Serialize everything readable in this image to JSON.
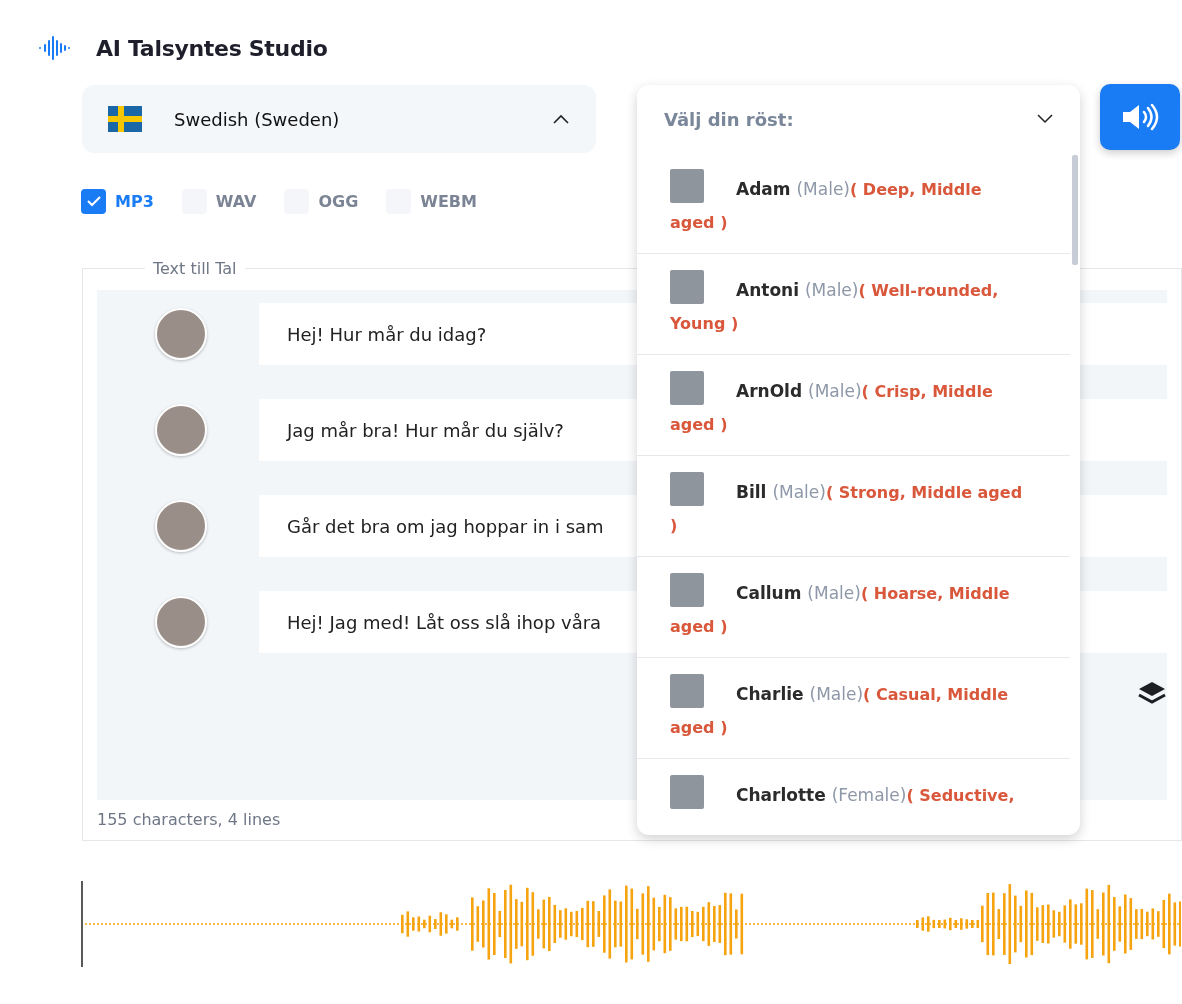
{
  "app": {
    "title": "AI Talsyntes Studio"
  },
  "language": {
    "value": "Swedish (Sweden)",
    "expanded": true
  },
  "voice_select": {
    "placeholder": "Välj din röst:",
    "expanded": true,
    "voices": [
      {
        "name": "Adam",
        "gender": "(Male)",
        "traits": "( Deep, Middle aged )"
      },
      {
        "name": "Antoni",
        "gender": "(Male)",
        "traits": "( Well-rounded, Young )"
      },
      {
        "name": "ArnOld",
        "gender": "(Male)",
        "traits": "( Crisp, Middle aged )"
      },
      {
        "name": "Bill",
        "gender": "(Male)",
        "traits": "( Strong, Middle aged )"
      },
      {
        "name": "Callum",
        "gender": "(Male)",
        "traits": "( Hoarse, Middle aged )"
      },
      {
        "name": "Charlie",
        "gender": "(Male)",
        "traits": "( Casual, Middle aged )"
      },
      {
        "name": "Charlotte",
        "gender": "(Female)",
        "traits": "( Seductive,"
      }
    ]
  },
  "formats": [
    {
      "label": "MP3",
      "checked": true
    },
    {
      "label": "WAV",
      "checked": false
    },
    {
      "label": "OGG",
      "checked": false
    },
    {
      "label": "WEBM",
      "checked": false
    }
  ],
  "editor": {
    "legend": "Text till Tal",
    "lines": [
      {
        "text": "Hej! Hur mår du idag?"
      },
      {
        "text": "Jag mår bra! Hur mår du själv?"
      },
      {
        "text": "Går det bra om jag hoppar in i sam"
      },
      {
        "text": "Hej! Jag med! Låt oss slå ihop våra"
      }
    ],
    "status": "155 characters, 4 lines"
  }
}
